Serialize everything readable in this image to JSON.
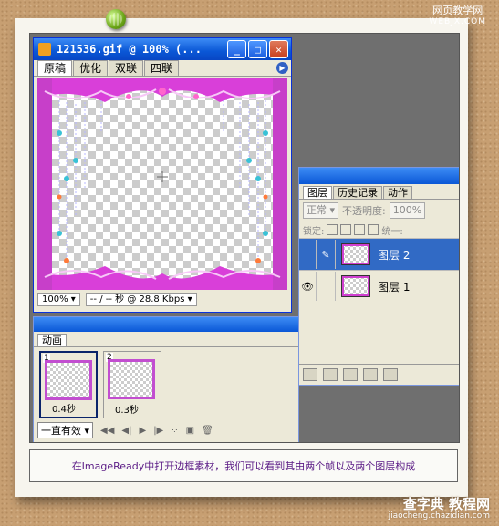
{
  "watermark_top": {
    "line1": "网页教学网",
    "line2": "WEBJX.COM"
  },
  "document": {
    "title": "121536.gif @ 100% (...",
    "tabs": [
      "原稿",
      "优化",
      "双联",
      "四联"
    ],
    "zoom": "100%",
    "status": "-- / -- 秒 @ 28.8 Kbps"
  },
  "layers_panel": {
    "tabs": [
      "图层",
      "历史记录",
      "动作"
    ],
    "blend_mode": "正常",
    "opacity_label": "不透明度:",
    "opacity_value": "100%",
    "lock_label": "锁定:",
    "unify_label": "统一:",
    "layers": [
      {
        "name": "图层 2",
        "selected": true
      },
      {
        "name": "图层 1",
        "selected": false
      }
    ]
  },
  "animation_panel": {
    "tab": "动画",
    "frames": [
      {
        "number": "1",
        "delay": "0.4秒"
      },
      {
        "number": "2",
        "delay": "0.3秒"
      }
    ],
    "loop": "一直有效"
  },
  "caption": "在ImageReady中打开边框素材，我们可以看到其由两个帧以及两个图层构成",
  "watermark_bottom": {
    "line1": "查字典 教程网",
    "line2": "jiaocheng.chazidian.com"
  },
  "colors": {
    "frame_magenta": "#d93fd9",
    "selection_blue": "#316ac5",
    "caption_text": "#5a1a85"
  }
}
